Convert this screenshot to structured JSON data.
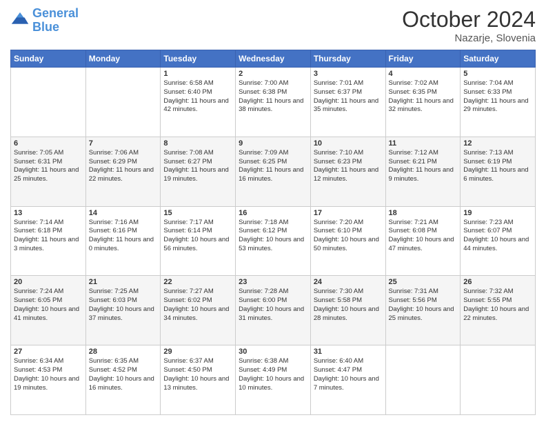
{
  "header": {
    "logo_line1": "General",
    "logo_line2": "Blue",
    "month": "October 2024",
    "location": "Nazarje, Slovenia"
  },
  "weekdays": [
    "Sunday",
    "Monday",
    "Tuesday",
    "Wednesday",
    "Thursday",
    "Friday",
    "Saturday"
  ],
  "weeks": [
    [
      {
        "day": "",
        "sunrise": "",
        "sunset": "",
        "daylight": ""
      },
      {
        "day": "",
        "sunrise": "",
        "sunset": "",
        "daylight": ""
      },
      {
        "day": "1",
        "sunrise": "Sunrise: 6:58 AM",
        "sunset": "Sunset: 6:40 PM",
        "daylight": "Daylight: 11 hours and 42 minutes."
      },
      {
        "day": "2",
        "sunrise": "Sunrise: 7:00 AM",
        "sunset": "Sunset: 6:38 PM",
        "daylight": "Daylight: 11 hours and 38 minutes."
      },
      {
        "day": "3",
        "sunrise": "Sunrise: 7:01 AM",
        "sunset": "Sunset: 6:37 PM",
        "daylight": "Daylight: 11 hours and 35 minutes."
      },
      {
        "day": "4",
        "sunrise": "Sunrise: 7:02 AM",
        "sunset": "Sunset: 6:35 PM",
        "daylight": "Daylight: 11 hours and 32 minutes."
      },
      {
        "day": "5",
        "sunrise": "Sunrise: 7:04 AM",
        "sunset": "Sunset: 6:33 PM",
        "daylight": "Daylight: 11 hours and 29 minutes."
      }
    ],
    [
      {
        "day": "6",
        "sunrise": "Sunrise: 7:05 AM",
        "sunset": "Sunset: 6:31 PM",
        "daylight": "Daylight: 11 hours and 25 minutes."
      },
      {
        "day": "7",
        "sunrise": "Sunrise: 7:06 AM",
        "sunset": "Sunset: 6:29 PM",
        "daylight": "Daylight: 11 hours and 22 minutes."
      },
      {
        "day": "8",
        "sunrise": "Sunrise: 7:08 AM",
        "sunset": "Sunset: 6:27 PM",
        "daylight": "Daylight: 11 hours and 19 minutes."
      },
      {
        "day": "9",
        "sunrise": "Sunrise: 7:09 AM",
        "sunset": "Sunset: 6:25 PM",
        "daylight": "Daylight: 11 hours and 16 minutes."
      },
      {
        "day": "10",
        "sunrise": "Sunrise: 7:10 AM",
        "sunset": "Sunset: 6:23 PM",
        "daylight": "Daylight: 11 hours and 12 minutes."
      },
      {
        "day": "11",
        "sunrise": "Sunrise: 7:12 AM",
        "sunset": "Sunset: 6:21 PM",
        "daylight": "Daylight: 11 hours and 9 minutes."
      },
      {
        "day": "12",
        "sunrise": "Sunrise: 7:13 AM",
        "sunset": "Sunset: 6:19 PM",
        "daylight": "Daylight: 11 hours and 6 minutes."
      }
    ],
    [
      {
        "day": "13",
        "sunrise": "Sunrise: 7:14 AM",
        "sunset": "Sunset: 6:18 PM",
        "daylight": "Daylight: 11 hours and 3 minutes."
      },
      {
        "day": "14",
        "sunrise": "Sunrise: 7:16 AM",
        "sunset": "Sunset: 6:16 PM",
        "daylight": "Daylight: 11 hours and 0 minutes."
      },
      {
        "day": "15",
        "sunrise": "Sunrise: 7:17 AM",
        "sunset": "Sunset: 6:14 PM",
        "daylight": "Daylight: 10 hours and 56 minutes."
      },
      {
        "day": "16",
        "sunrise": "Sunrise: 7:18 AM",
        "sunset": "Sunset: 6:12 PM",
        "daylight": "Daylight: 10 hours and 53 minutes."
      },
      {
        "day": "17",
        "sunrise": "Sunrise: 7:20 AM",
        "sunset": "Sunset: 6:10 PM",
        "daylight": "Daylight: 10 hours and 50 minutes."
      },
      {
        "day": "18",
        "sunrise": "Sunrise: 7:21 AM",
        "sunset": "Sunset: 6:08 PM",
        "daylight": "Daylight: 10 hours and 47 minutes."
      },
      {
        "day": "19",
        "sunrise": "Sunrise: 7:23 AM",
        "sunset": "Sunset: 6:07 PM",
        "daylight": "Daylight: 10 hours and 44 minutes."
      }
    ],
    [
      {
        "day": "20",
        "sunrise": "Sunrise: 7:24 AM",
        "sunset": "Sunset: 6:05 PM",
        "daylight": "Daylight: 10 hours and 41 minutes."
      },
      {
        "day": "21",
        "sunrise": "Sunrise: 7:25 AM",
        "sunset": "Sunset: 6:03 PM",
        "daylight": "Daylight: 10 hours and 37 minutes."
      },
      {
        "day": "22",
        "sunrise": "Sunrise: 7:27 AM",
        "sunset": "Sunset: 6:02 PM",
        "daylight": "Daylight: 10 hours and 34 minutes."
      },
      {
        "day": "23",
        "sunrise": "Sunrise: 7:28 AM",
        "sunset": "Sunset: 6:00 PM",
        "daylight": "Daylight: 10 hours and 31 minutes."
      },
      {
        "day": "24",
        "sunrise": "Sunrise: 7:30 AM",
        "sunset": "Sunset: 5:58 PM",
        "daylight": "Daylight: 10 hours and 28 minutes."
      },
      {
        "day": "25",
        "sunrise": "Sunrise: 7:31 AM",
        "sunset": "Sunset: 5:56 PM",
        "daylight": "Daylight: 10 hours and 25 minutes."
      },
      {
        "day": "26",
        "sunrise": "Sunrise: 7:32 AM",
        "sunset": "Sunset: 5:55 PM",
        "daylight": "Daylight: 10 hours and 22 minutes."
      }
    ],
    [
      {
        "day": "27",
        "sunrise": "Sunrise: 6:34 AM",
        "sunset": "Sunset: 4:53 PM",
        "daylight": "Daylight: 10 hours and 19 minutes."
      },
      {
        "day": "28",
        "sunrise": "Sunrise: 6:35 AM",
        "sunset": "Sunset: 4:52 PM",
        "daylight": "Daylight: 10 hours and 16 minutes."
      },
      {
        "day": "29",
        "sunrise": "Sunrise: 6:37 AM",
        "sunset": "Sunset: 4:50 PM",
        "daylight": "Daylight: 10 hours and 13 minutes."
      },
      {
        "day": "30",
        "sunrise": "Sunrise: 6:38 AM",
        "sunset": "Sunset: 4:49 PM",
        "daylight": "Daylight: 10 hours and 10 minutes."
      },
      {
        "day": "31",
        "sunrise": "Sunrise: 6:40 AM",
        "sunset": "Sunset: 4:47 PM",
        "daylight": "Daylight: 10 hours and 7 minutes."
      },
      {
        "day": "",
        "sunrise": "",
        "sunset": "",
        "daylight": ""
      },
      {
        "day": "",
        "sunrise": "",
        "sunset": "",
        "daylight": ""
      }
    ]
  ]
}
